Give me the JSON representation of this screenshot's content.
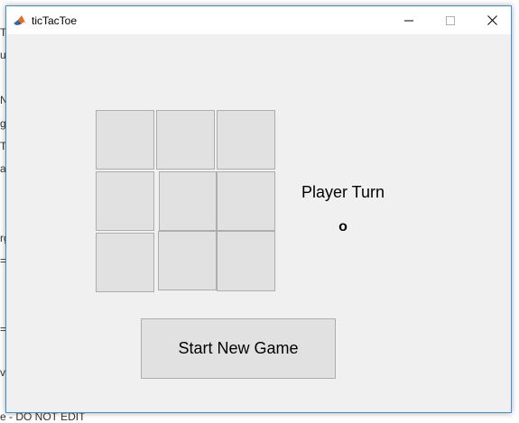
{
  "window": {
    "title": "ticTacToe",
    "icon": "matlab-icon"
  },
  "controls": {
    "minimize": "minimize-icon",
    "maximize": "maximize-icon",
    "close": "close-icon"
  },
  "board": {
    "cells": [
      "",
      "",
      "",
      "",
      "",
      "",
      "",
      "",
      ""
    ]
  },
  "status": {
    "label": "Player Turn",
    "current_player": "o"
  },
  "actions": {
    "start_label": "Start New Game"
  },
  "background": {
    "fragments": [
      "T",
      "ur",
      "N",
      "g",
      "T",
      "ac",
      "rg",
      "=",
      "=",
      "v",
      "e - DO NOT EDIT"
    ]
  },
  "colors": {
    "window_bg": "#f0f0f0",
    "button_bg": "#e1e1e1",
    "button_border": "#adadad",
    "window_border": "#3c8fd8"
  }
}
